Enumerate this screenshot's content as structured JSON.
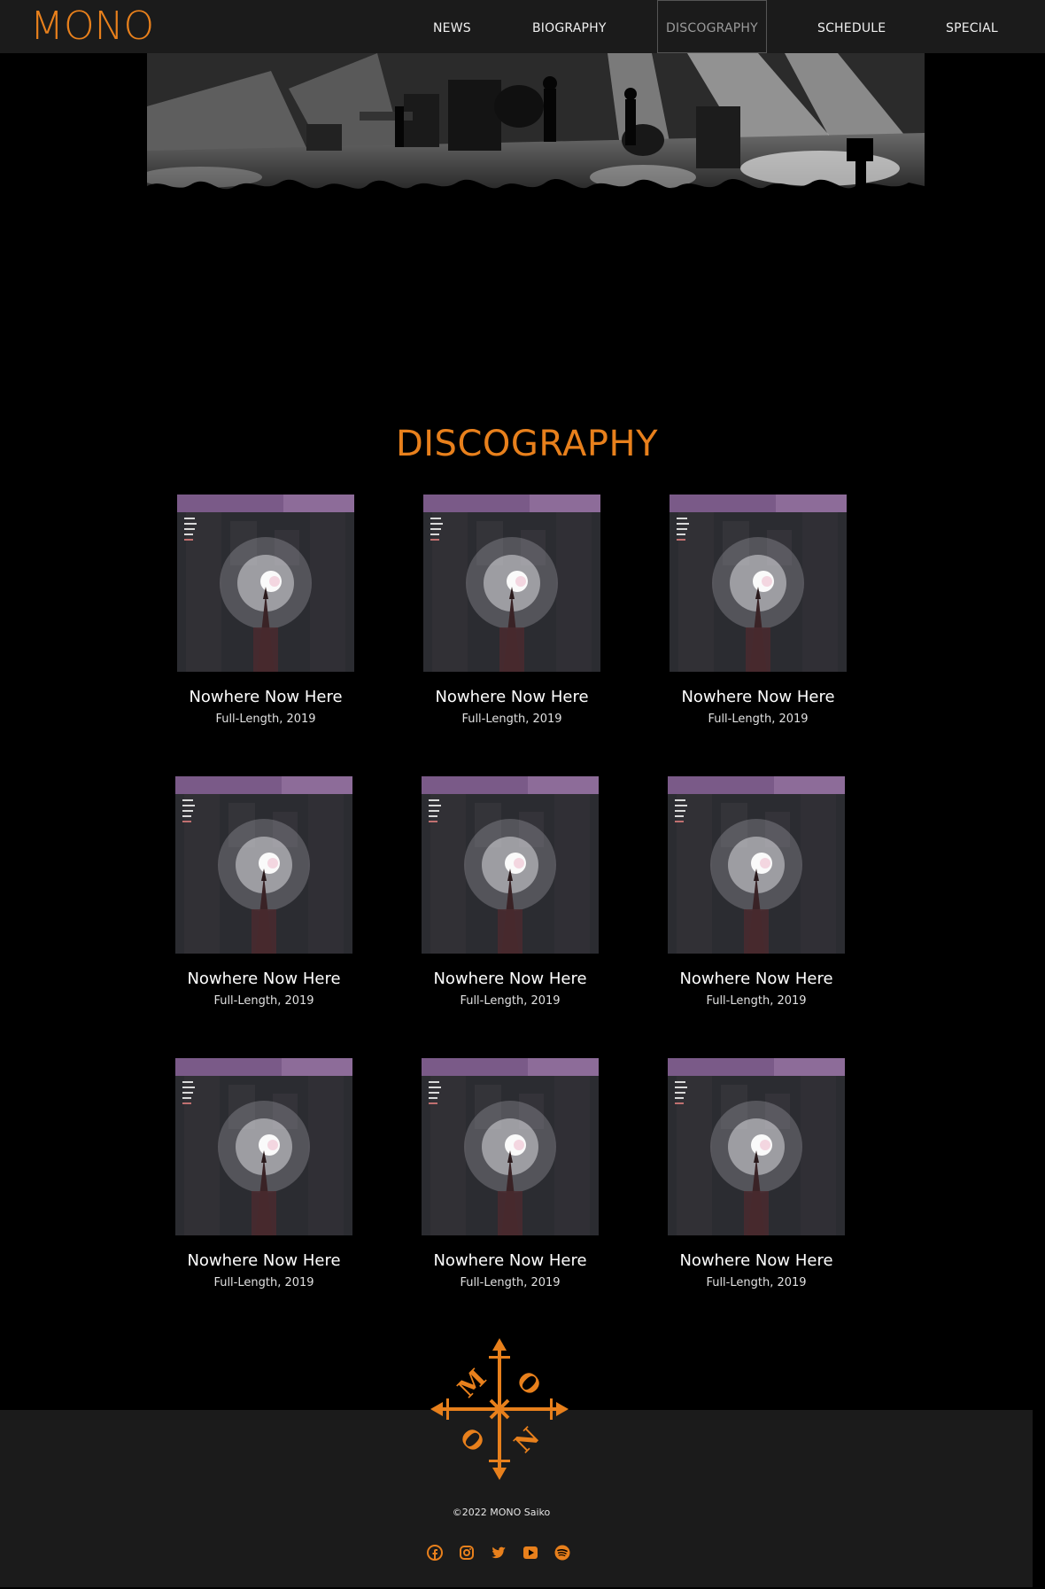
{
  "brand": {
    "logo": "MONO",
    "accent_color": "#e8801c"
  },
  "nav": {
    "items": [
      {
        "label": "NEWS",
        "active": false
      },
      {
        "label": "BIOGRAPHY",
        "active": false
      },
      {
        "label": "DISCOGRAPHY",
        "active": true
      },
      {
        "label": "SCHEDULE",
        "active": false
      },
      {
        "label": "SPECIAL",
        "active": false
      }
    ]
  },
  "hero": {
    "image": "concert-stage-crowd-photo"
  },
  "section": {
    "title": "DISCOGRAPHY"
  },
  "albums": [
    {
      "title": "Nowhere Now Here",
      "subtitle": "Full-Length, 2019",
      "cover": "album-cover-art"
    },
    {
      "title": "Nowhere Now Here",
      "subtitle": "Full-Length, 2019",
      "cover": "album-cover-art"
    },
    {
      "title": "Nowhere Now Here",
      "subtitle": "Full-Length, 2019",
      "cover": "album-cover-art"
    },
    {
      "title": "Nowhere Now Here",
      "subtitle": "Full-Length, 2019",
      "cover": "album-cover-art"
    },
    {
      "title": "Nowhere Now Here",
      "subtitle": "Full-Length, 2019",
      "cover": "album-cover-art"
    },
    {
      "title": "Nowhere Now Here",
      "subtitle": "Full-Length, 2019",
      "cover": "album-cover-art"
    },
    {
      "title": "Nowhere Now Here",
      "subtitle": "Full-Length, 2019",
      "cover": "album-cover-art"
    },
    {
      "title": "Nowhere Now Here",
      "subtitle": "Full-Length, 2019",
      "cover": "album-cover-art"
    },
    {
      "title": "Nowhere Now Here",
      "subtitle": "Full-Length, 2019",
      "cover": "album-cover-art"
    }
  ],
  "footer": {
    "emblem_letters": [
      "M",
      "O",
      "N",
      "O"
    ],
    "copyright": "©2022 MONO Saiko",
    "social": [
      "facebook-icon",
      "instagram-icon",
      "twitter-icon",
      "youtube-icon",
      "spotify-icon"
    ]
  }
}
